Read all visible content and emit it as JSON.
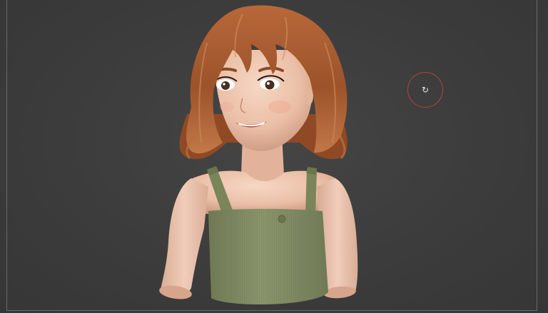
{
  "viewport": {
    "background_color": "#3c3c3c",
    "border_color": "#6a6a6a"
  },
  "model": {
    "subject": "3d-stylized-girl-bust",
    "hair_color": "#a85a2c",
    "skin_color": "#eec3ab",
    "top_color": "#7f8a62"
  },
  "gizmo": {
    "icon": "rotate-icon",
    "glyph": "↻",
    "ring_color": "#b0443e"
  }
}
